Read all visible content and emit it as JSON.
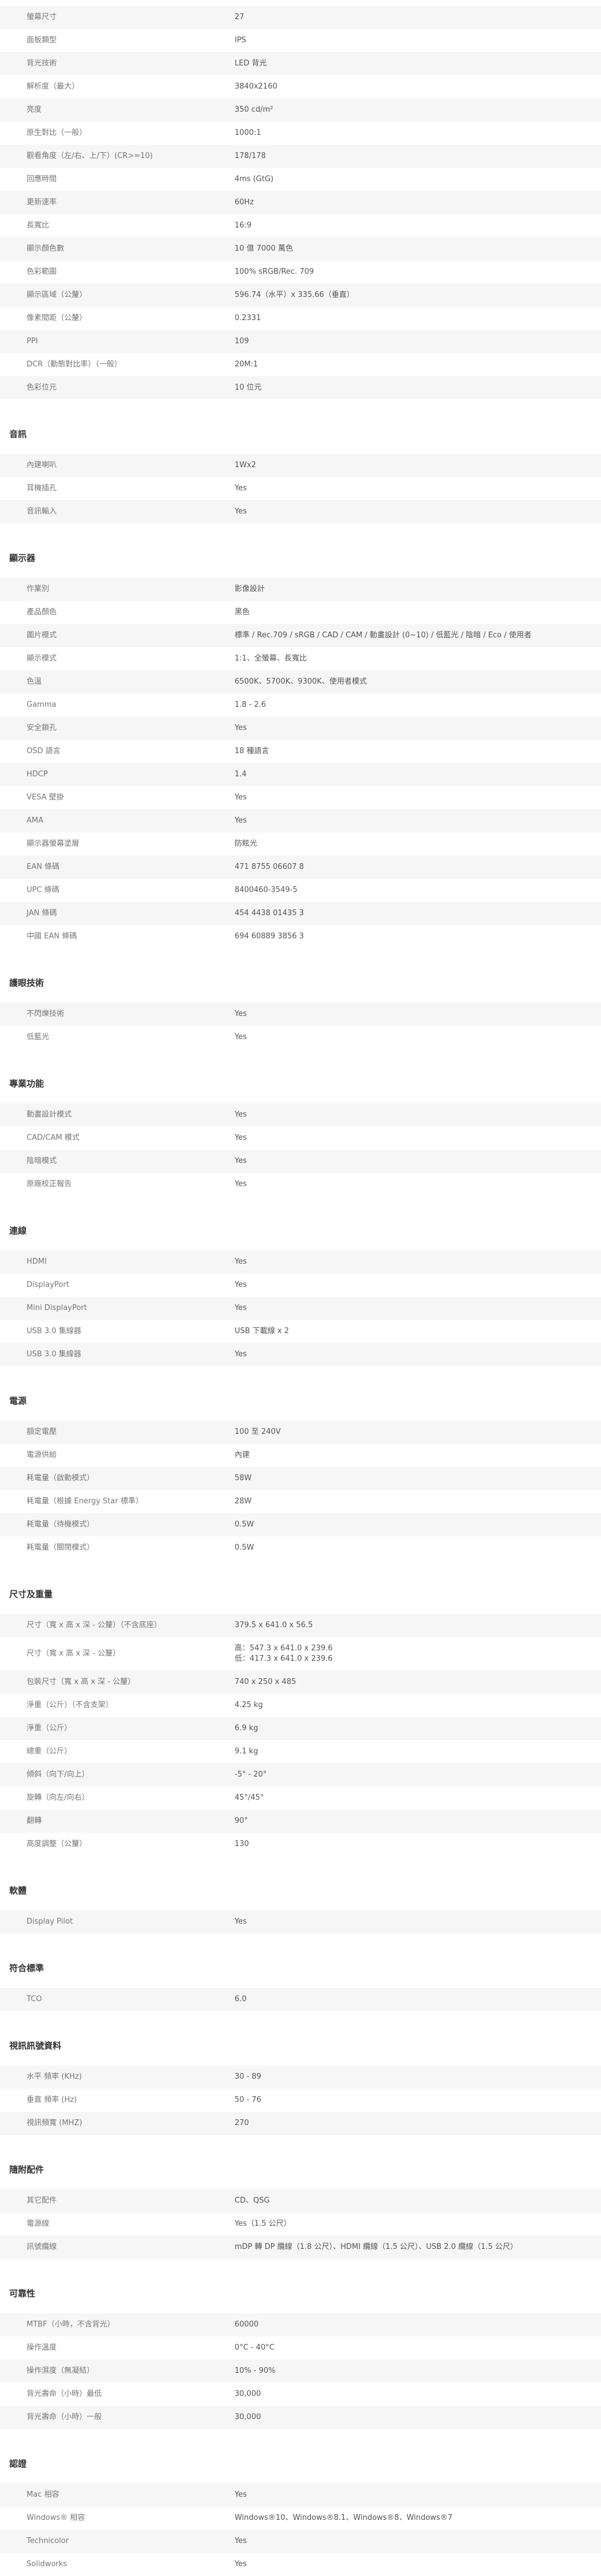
{
  "sections": [
    {
      "title": "",
      "rows": [
        {
          "label": "螢幕尺寸",
          "value": "27"
        },
        {
          "label": "面板類型",
          "value": "IPS"
        },
        {
          "label": "背光技術",
          "value": "LED 背光"
        },
        {
          "label": "解析度（最大）",
          "value": "3840x2160"
        },
        {
          "label": "亮度",
          "value": "350 cd/m²"
        },
        {
          "label": "原生對比（一般）",
          "value": "1000:1"
        },
        {
          "label": "觀看角度（左/右、上/下）(CR>=10)",
          "value": "178/178"
        },
        {
          "label": "回應時間",
          "value": "4ms (GtG)"
        },
        {
          "label": "更新速率",
          "value": "60Hz"
        },
        {
          "label": "長寬比",
          "value": "16:9"
        },
        {
          "label": "顯示顏色數",
          "value": "10 億 7000 萬色"
        },
        {
          "label": "色彩範圍",
          "value": "100% sRGB/Rec. 709"
        },
        {
          "label": "顯示區域（公釐）",
          "value": "596.74（水平）x 335.66（垂直）"
        },
        {
          "label": "像素間距（公釐）",
          "value": "0.2331"
        },
        {
          "label": "PPI",
          "value": "109"
        },
        {
          "label": "DCR（動態對比率）（一般）",
          "value": "20M:1"
        },
        {
          "label": "色彩位元",
          "value": "10 位元"
        }
      ]
    },
    {
      "title": "音訊",
      "rows": [
        {
          "label": "內建喇叭",
          "value": "1Wx2"
        },
        {
          "label": "耳機插孔",
          "value": "Yes"
        },
        {
          "label": "音訊輸入",
          "value": "Yes"
        }
      ]
    },
    {
      "title": "顯示器",
      "rows": [
        {
          "label": "作業別",
          "value": "影像設計"
        },
        {
          "label": "產品顏色",
          "value": "黑色"
        },
        {
          "label": "圖片模式",
          "value": "標準 / Rec.709 / sRGB / CAD / CAM / 動畫設計 (0~10) / 低藍光 / 陰暗 / Eco / 使用者"
        },
        {
          "label": "顯示模式",
          "value": "1:1、全螢幕、長寬比"
        },
        {
          "label": "色溫",
          "value": "6500K、5700K、9300K、使用者模式"
        },
        {
          "label": "Gamma",
          "value": "1.8 - 2.6"
        },
        {
          "label": "安全鎖孔",
          "value": "Yes"
        },
        {
          "label": "OSD 語言",
          "value": "18 種語言"
        },
        {
          "label": "HDCP",
          "value": "1.4"
        },
        {
          "label": "VESA 壁掛",
          "value": "Yes"
        },
        {
          "label": "AMA",
          "value": "Yes"
        },
        {
          "label": "顯示器螢幕塗層",
          "value": "防眩光"
        },
        {
          "label": "EAN 條碼",
          "value": "471 8755 06607 8"
        },
        {
          "label": "UPC 條碼",
          "value": "8400460-3549-5"
        },
        {
          "label": "JAN 條碼",
          "value": "454 4438 01435 3"
        },
        {
          "label": "中國 EAN 條碼",
          "value": "694 60889 3856 3"
        }
      ]
    },
    {
      "title": "護眼技術",
      "rows": [
        {
          "label": "不閃爍技術",
          "value": "Yes"
        },
        {
          "label": "低藍光",
          "value": "Yes"
        }
      ]
    },
    {
      "title": "專業功能",
      "rows": [
        {
          "label": "動畫設計模式",
          "value": "Yes"
        },
        {
          "label": "CAD/CAM 模式",
          "value": "Yes"
        },
        {
          "label": "陰暗模式",
          "value": "Yes"
        },
        {
          "label": "原廠校正報告",
          "value": "Yes"
        }
      ]
    },
    {
      "title": "連線",
      "rows": [
        {
          "label": "HDMI",
          "value": "Yes"
        },
        {
          "label": "DisplayPort",
          "value": "Yes"
        },
        {
          "label": "Mini DisplayPort",
          "value": "Yes"
        },
        {
          "label": "USB 3.0 集線器",
          "value": "USB 下載線 x 2"
        },
        {
          "label": "USB 3.0 集線器",
          "value": "Yes"
        }
      ]
    },
    {
      "title": "電源",
      "rows": [
        {
          "label": "額定電壓",
          "value": "100 至 240V"
        },
        {
          "label": "電源供給",
          "value": "內建"
        },
        {
          "label": "耗電量（啟動模式）",
          "value": "58W"
        },
        {
          "label": "耗電量（根據 Energy Star 標準）",
          "value": "28W"
        },
        {
          "label": "耗電量（待機模式）",
          "value": "0.5W"
        },
        {
          "label": "耗電量（關閉模式）",
          "value": "0.5W"
        }
      ]
    },
    {
      "title": "尺寸及重量",
      "rows": [
        {
          "label": "尺寸（寬 x 高 x 深 - 公釐）（不含底座）",
          "value": "379.5 x 641.0 x 56.5"
        },
        {
          "label": "尺寸（寬 x 高 x 深 - 公釐）",
          "value": "高：547.3 x 641.0 x 239.6\n低：417.3 x 641.0 x 239.6",
          "tall": true
        },
        {
          "label": "包裝尺寸（寬 x 高 x 深 - 公釐）",
          "value": "740 x 250 x 485"
        },
        {
          "label": "淨重（公斤）（不含支架）",
          "value": "4.25 kg"
        },
        {
          "label": "淨重（公斤）",
          "value": "6.9 kg"
        },
        {
          "label": "總重（公斤）",
          "value": "9.1 kg"
        },
        {
          "label": "傾斜（向下/向上）",
          "value": "-5° - 20°"
        },
        {
          "label": "旋轉（向左/向右）",
          "value": "45°/45°"
        },
        {
          "label": "翻轉",
          "value": "90°"
        },
        {
          "label": "高度調整（公釐）",
          "value": "130"
        }
      ]
    },
    {
      "title": "軟體",
      "rows": [
        {
          "label": "Display Pilot",
          "value": "Yes"
        }
      ]
    },
    {
      "title": "符合標準",
      "rows": [
        {
          "label": "TCO",
          "value": "6.0"
        }
      ]
    },
    {
      "title": "視訊訊號資料",
      "rows": [
        {
          "label": "水平 頻率 (KHz)",
          "value": "30 - 89"
        },
        {
          "label": "垂直 頻率 (Hz)",
          "value": "50 - 76"
        },
        {
          "label": "視訊頻寬 (MHZ)",
          "value": "270"
        }
      ]
    },
    {
      "title": "隨附配件",
      "rows": [
        {
          "label": "其它配件",
          "value": "CD、QSG"
        },
        {
          "label": "電源線",
          "value": "Yes（1.5 公尺）"
        },
        {
          "label": "訊號纜線",
          "value": "mDP 轉 DP 纜線（1.8 公尺）、HDMI 纜線（1.5 公尺）、USB 2.0 纜線（1.5 公尺）"
        }
      ]
    },
    {
      "title": "可靠性",
      "rows": [
        {
          "label": "MTBF（小時，不含背光）",
          "value": "60000"
        },
        {
          "label": "操作溫度",
          "value": "0°C - 40°C"
        },
        {
          "label": "操作濕度（無凝結）",
          "value": "10% - 90%"
        },
        {
          "label": "背光壽命（小時）最低",
          "value": "30,000"
        },
        {
          "label": "背光壽命（小時）一般",
          "value": "30,000"
        }
      ]
    },
    {
      "title": "認證",
      "rows": [
        {
          "label": "Mac 相容",
          "value": "Yes"
        },
        {
          "label": "Windows® 相容",
          "value": "Windows®10、Windows®8.1、Windows®8、Windows®7"
        },
        {
          "label": "Technicolor",
          "value": "Yes"
        },
        {
          "label": "Solidworks",
          "value": "Yes"
        }
      ]
    }
  ]
}
